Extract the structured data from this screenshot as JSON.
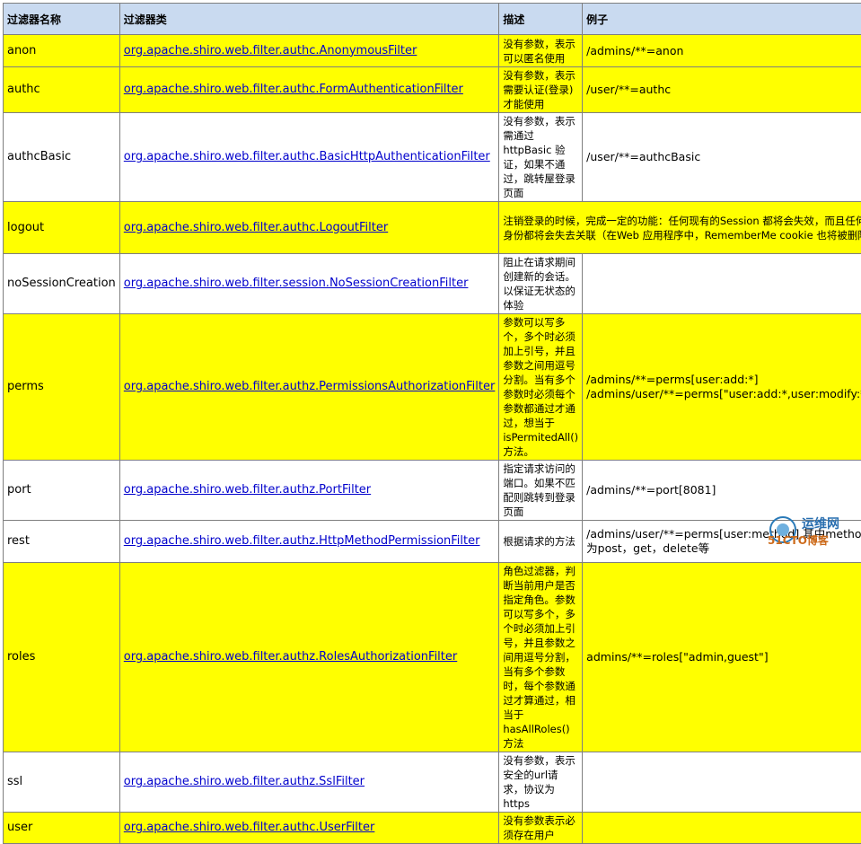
{
  "headers": [
    "过滤器名称",
    "过滤器类",
    "描述",
    "例子"
  ],
  "rows": [
    {
      "name": "anon",
      "cls": "org.apache.shiro.web.filter.authc.AnonymousFilter",
      "desc": "没有参数，表示可以匿名使用",
      "ex": "/admins/**=anon"
    },
    {
      "name": "authc",
      "cls": "org.apache.shiro.web.filter.authc.FormAuthenticationFilter",
      "desc": "没有参数，表示需要认证(登录)才能使用",
      "ex": "/user/**=authc"
    },
    {
      "name": "authcBasic",
      "cls": "org.apache.shiro.web.filter.authc.BasicHttpAuthenticationFilter",
      "desc": "没有参数，表示需通过httpBasic 验证，如果不通过，跳转屋登录页面",
      "ex": "/user/**=authcBasic"
    },
    {
      "name": "logout",
      "cls": "org.apache.shiro.web.filter.authc.LogoutFilter",
      "desc": "注销登录的时候，完成一定的功能：任何现有的Session 都将会失效，而且任何身份都将会失去关联（在Web 应用程序中，RememberMe cookie 也将被删除）",
      "ex": ""
    },
    {
      "name": "noSessionCreation",
      "cls": "org.apache.shiro.web.filter.session.NoSessionCreationFilter",
      "desc": "阻止在请求期间创建新的会话。以保证无状态的体验",
      "ex": ""
    },
    {
      "name": "perms",
      "cls": "org.apache.shiro.web.filter.authz.PermissionsAuthorizationFilter",
      "desc": "参数可以写多个，多个时必须加上引号，并且参数之间用逗号分割。当有多个参数时必须每个参数都通过才通过，想当于isPermitedAll()方法。",
      "ex": "/admins/**=perms[user:add:*] /admins/user/**=perms[\"user:add:*,user:modify:*\"]"
    },
    {
      "name": "port",
      "cls": "org.apache.shiro.web.filter.authz.PortFilter",
      "desc": "指定请求访问的端口。如果不匹配则跳转到登录页面",
      "ex": "/admins/**=port[8081]"
    },
    {
      "name": "rest",
      "cls": "org.apache.shiro.web.filter.authz.HttpMethodPermissionFilter",
      "desc": "根据请求的方法",
      "ex": "/admins/user/**=perms[user:method],其中method为post，get，delete等"
    },
    {
      "name": "roles",
      "cls": "org.apache.shiro.web.filter.authz.RolesAuthorizationFilter",
      "desc": "角色过滤器，判断当前用户是否指定角色。参数可以写多个，多个时必须加上引号，并且参数之间用逗号分割，当有多个参数时，每个参数通过才算通过，相当于hasAllRoles()方法",
      "ex": "admins/**=roles[\"admin,guest\"]"
    },
    {
      "name": "ssl",
      "cls": "org.apache.shiro.web.filter.authz.SslFilter",
      "desc": "没有参数，表示安全的url请求，协议为 https",
      "ex": ""
    },
    {
      "name": "user",
      "cls": "org.apache.shiro.web.filter.authc.UserFilter",
      "desc": "没有参数表示必须存在用户",
      "ex": ""
    }
  ],
  "watermark": {
    "line1": "运维网",
    "line2": "51CTO博客"
  }
}
